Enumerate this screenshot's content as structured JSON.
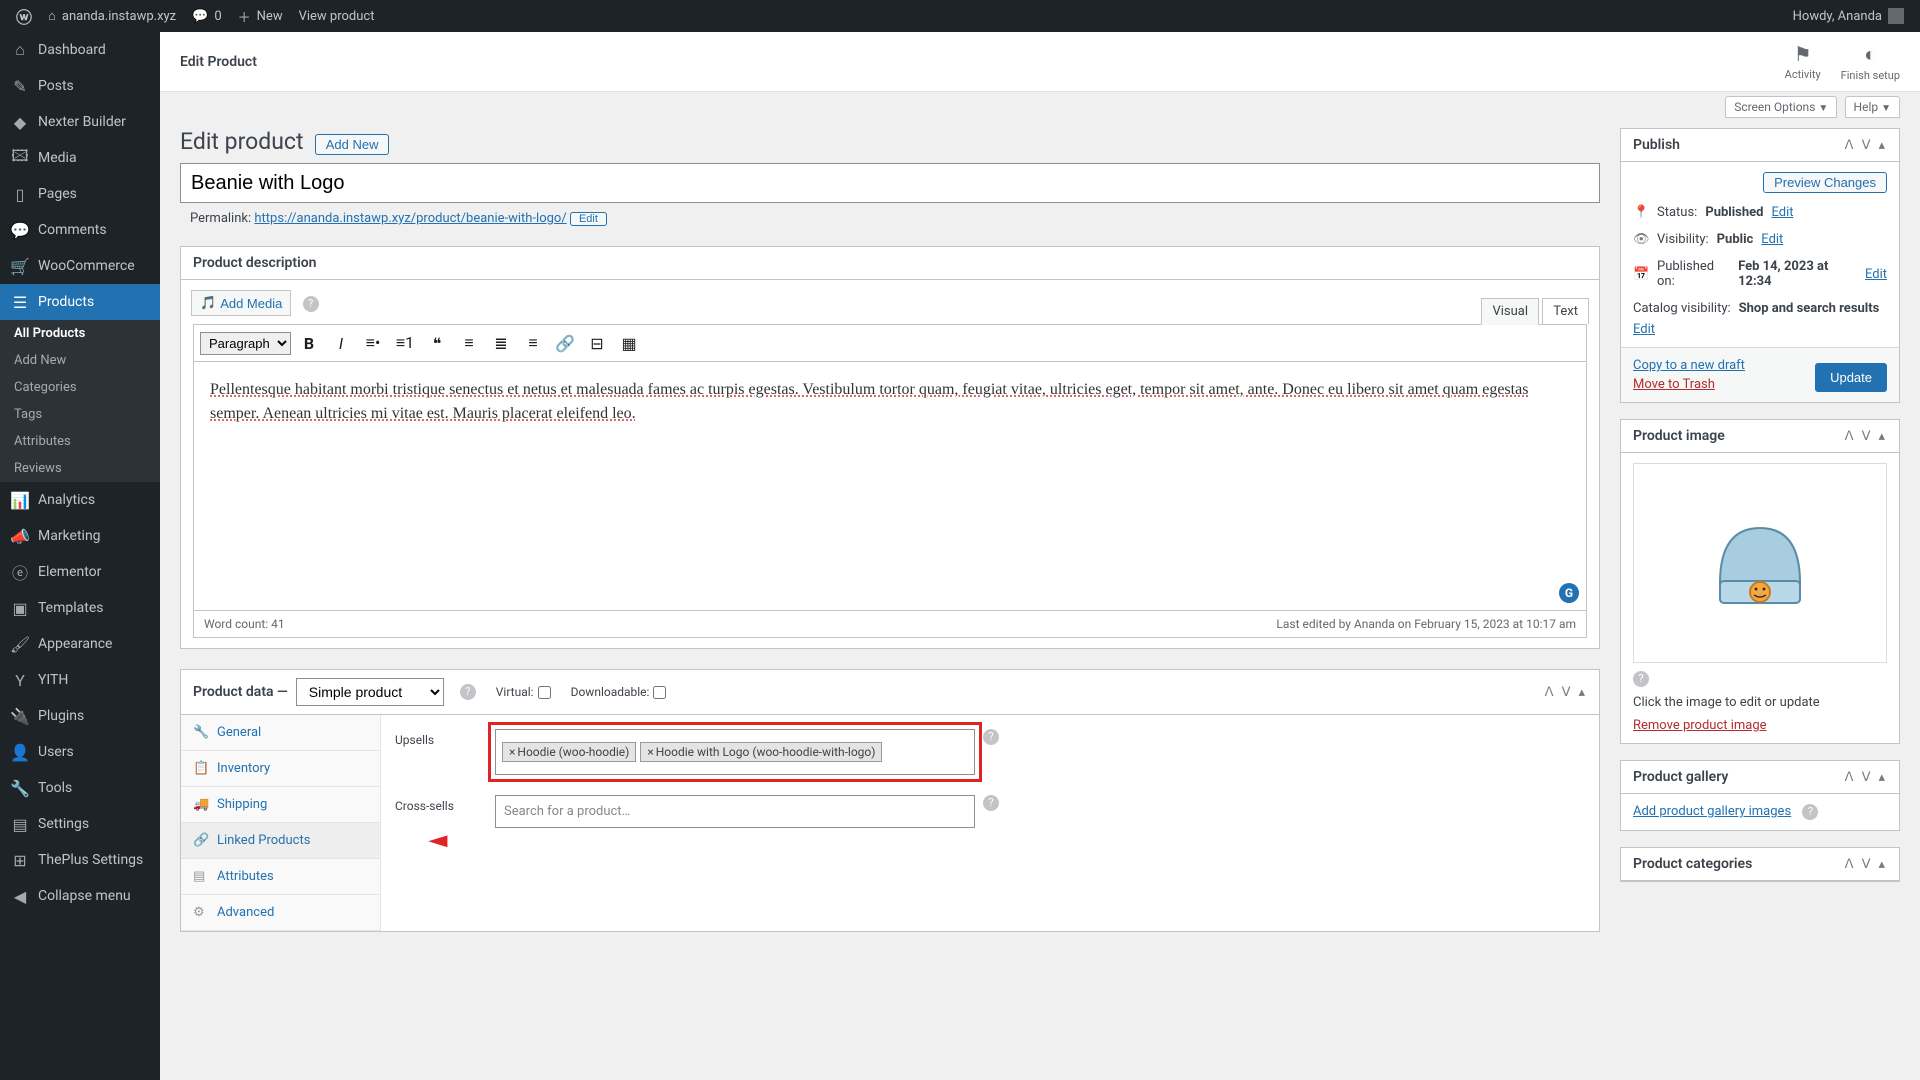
{
  "adminbar": {
    "site": "ananda.instawp.xyz",
    "comments": "0",
    "new": "New",
    "view": "View product",
    "howdy": "Howdy, Ananda"
  },
  "header": {
    "title": "Edit Product",
    "activity": "Activity",
    "finish": "Finish setup",
    "screen_options": "Screen Options",
    "help": "Help"
  },
  "sidebar": {
    "items": [
      {
        "icon": "⌂",
        "label": "Dashboard"
      },
      {
        "icon": "✎",
        "label": "Posts"
      },
      {
        "icon": "◆",
        "label": "Nexter Builder"
      },
      {
        "icon": "🖾",
        "label": "Media"
      },
      {
        "icon": "▯",
        "label": "Pages"
      },
      {
        "icon": "💬",
        "label": "Comments"
      },
      {
        "icon": "🛒",
        "label": "WooCommerce"
      },
      {
        "icon": "☰",
        "label": "Products",
        "active": true
      },
      {
        "icon": "📊",
        "label": "Analytics"
      },
      {
        "icon": "📣",
        "label": "Marketing"
      },
      {
        "icon": "ⓔ",
        "label": "Elementor"
      },
      {
        "icon": "▣",
        "label": "Templates"
      },
      {
        "icon": "🖌",
        "label": "Appearance"
      },
      {
        "icon": "Y",
        "label": "YITH"
      },
      {
        "icon": "🔌",
        "label": "Plugins"
      },
      {
        "icon": "👤",
        "label": "Users"
      },
      {
        "icon": "🔧",
        "label": "Tools"
      },
      {
        "icon": "▤",
        "label": "Settings"
      },
      {
        "icon": "⊞",
        "label": "ThePlus Settings"
      },
      {
        "icon": "◀",
        "label": "Collapse menu"
      }
    ],
    "sub": [
      "All Products",
      "Add New",
      "Categories",
      "Tags",
      "Attributes",
      "Reviews"
    ]
  },
  "page": {
    "heading": "Edit product",
    "add_new": "Add New",
    "title_value": "Beanie with Logo",
    "permalink_label": "Permalink:",
    "permalink_base": "https://ananda.instawp.xyz/product/",
    "permalink_slug": "beanie-with-logo/",
    "permalink_edit": "Edit"
  },
  "editor": {
    "box_title": "Product description",
    "add_media": "Add Media",
    "tab_visual": "Visual",
    "tab_text": "Text",
    "format": "Paragraph",
    "content": "Pellentesque habitant morbi tristique senectus et netus et malesuada fames ac turpis egestas. Vestibulum tortor quam, feugiat vitae, ultricies eget, tempor sit amet, ante. Donec eu libero sit amet quam egestas semper. Aenean ultricies mi vitae est. Mauris placerat eleifend leo.",
    "word_count": "Word count: 41",
    "last_edited": "Last edited by Ananda on February 15, 2023 at 10:17 am"
  },
  "product_data": {
    "label": "Product data —",
    "type": "Simple product",
    "virtual": "Virtual:",
    "downloadable": "Downloadable:",
    "tabs": {
      "general": "General",
      "inventory": "Inventory",
      "shipping": "Shipping",
      "linked": "Linked Products",
      "attributes": "Attributes",
      "advanced": "Advanced"
    },
    "upsells_label": "Upsells",
    "upsells": [
      "Hoodie (woo-hoodie)",
      "Hoodie with Logo (woo-hoodie-with-logo)"
    ],
    "cross_label": "Cross-sells",
    "cross_placeholder": "Search for a product…"
  },
  "publish": {
    "title": "Publish",
    "preview": "Preview Changes",
    "status_label": "Status:",
    "status_value": "Published",
    "edit": "Edit",
    "visibility_label": "Visibility:",
    "visibility_value": "Public",
    "published_label": "Published on:",
    "published_value": "Feb 14, 2023 at 12:34",
    "catalog_label": "Catalog visibility:",
    "catalog_value": "Shop and search results",
    "copy": "Copy to a new draft",
    "trash": "Move to Trash",
    "update": "Update"
  },
  "product_image": {
    "title": "Product image",
    "hint": "Click the image to edit or update",
    "remove": "Remove product image"
  },
  "gallery": {
    "title": "Product gallery",
    "add": "Add product gallery images"
  },
  "categories": {
    "title": "Product categories"
  }
}
